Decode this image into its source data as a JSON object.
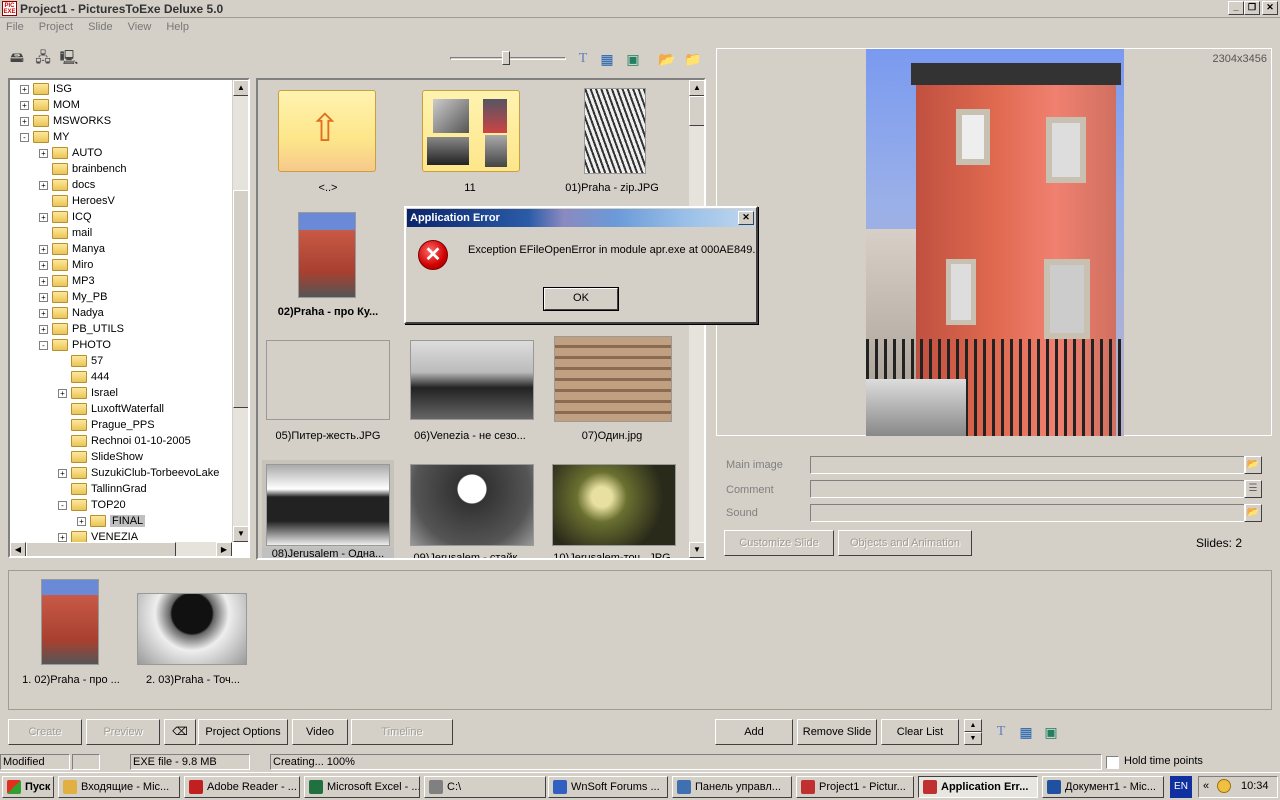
{
  "window": {
    "title": "Project1 - PicturesToExe Deluxe 5.0",
    "app_icon_text": "PIC EXE"
  },
  "menu": [
    "File",
    "Project",
    "Slide",
    "View",
    "Help"
  ],
  "tree": {
    "items": [
      {
        "label": "ISG",
        "indent": 1,
        "pm": "+"
      },
      {
        "label": "MOM",
        "indent": 1,
        "pm": "+"
      },
      {
        "label": "MSWORKS",
        "indent": 1,
        "pm": "+"
      },
      {
        "label": "MY",
        "indent": 1,
        "pm": "-"
      },
      {
        "label": "AUTO",
        "indent": 2,
        "pm": "+"
      },
      {
        "label": "brainbench",
        "indent": 2,
        "pm": ""
      },
      {
        "label": "docs",
        "indent": 2,
        "pm": "+"
      },
      {
        "label": "HeroesV",
        "indent": 2,
        "pm": ""
      },
      {
        "label": "ICQ",
        "indent": 2,
        "pm": "+"
      },
      {
        "label": "mail",
        "indent": 2,
        "pm": ""
      },
      {
        "label": "Manya",
        "indent": 2,
        "pm": "+"
      },
      {
        "label": "Miro",
        "indent": 2,
        "pm": "+"
      },
      {
        "label": "MP3",
        "indent": 2,
        "pm": "+"
      },
      {
        "label": "My_PB",
        "indent": 2,
        "pm": "+"
      },
      {
        "label": "Nadya",
        "indent": 2,
        "pm": "+"
      },
      {
        "label": "PB_UTILS",
        "indent": 2,
        "pm": "+"
      },
      {
        "label": "PHOTO",
        "indent": 2,
        "pm": "-"
      },
      {
        "label": "57",
        "indent": 3,
        "pm": ""
      },
      {
        "label": "444",
        "indent": 3,
        "pm": ""
      },
      {
        "label": "Israel",
        "indent": 3,
        "pm": "+"
      },
      {
        "label": "LuxoftWaterfall",
        "indent": 3,
        "pm": ""
      },
      {
        "label": "Prague_PPS",
        "indent": 3,
        "pm": ""
      },
      {
        "label": "Rechnoi 01-10-2005",
        "indent": 3,
        "pm": ""
      },
      {
        "label": "SlideShow",
        "indent": 3,
        "pm": ""
      },
      {
        "label": "SuzukiClub-TorbeevoLake",
        "indent": 3,
        "pm": "+"
      },
      {
        "label": "TallinnGrad",
        "indent": 3,
        "pm": ""
      },
      {
        "label": "TOP20",
        "indent": 3,
        "pm": "-"
      },
      {
        "label": "FINAL",
        "indent": 4,
        "pm": "+",
        "selected": true
      },
      {
        "label": "VENEZIA",
        "indent": 3,
        "pm": "+"
      }
    ]
  },
  "thumbs": [
    {
      "caption": "<..>",
      "kind": "up-folder"
    },
    {
      "caption": "11",
      "kind": "folder"
    },
    {
      "caption": "01)Praha - zip.JPG",
      "kind": "photo"
    },
    {
      "caption": "02)Praha - про Ку...",
      "kind": "photo",
      "bold": true
    },
    {
      "caption": "05)Питер-жесть.JPG",
      "kind": "photo"
    },
    {
      "caption": "06)Venezia - не сезо...",
      "kind": "photo"
    },
    {
      "caption": "07)Один.jpg",
      "kind": "photo"
    },
    {
      "caption": "08)Jerusalem - Одна...",
      "kind": "photo"
    },
    {
      "caption": "09)Jerusalem - стайк...",
      "kind": "photo"
    },
    {
      "caption": "10)Jerusalem-точ...JPG",
      "kind": "photo"
    }
  ],
  "preview": {
    "dimensions": "2304x3456"
  },
  "props": {
    "main_image_label": "Main image",
    "comment_label": "Comment",
    "sound_label": "Sound",
    "customize_label": "Customize Slide",
    "objects_label": "Objects and Animation",
    "slides_count": "Slides: 2"
  },
  "slides": [
    {
      "caption": "1. 02)Praha - про ..."
    },
    {
      "caption": "2. 03)Praha - Точ..."
    }
  ],
  "bottom": {
    "create": "Create",
    "preview": "Preview",
    "project_options": "Project Options",
    "video": "Video",
    "timeline": "Timeline",
    "add": "Add",
    "remove_slide": "Remove Slide",
    "clear_list": "Clear List"
  },
  "status": {
    "state": "Modified",
    "exe": "EXE file - 9.8 MB",
    "progress": "Creating... 100%",
    "hold": "Hold time points"
  },
  "dialog": {
    "title": "Application Error",
    "message": "Exception EFileOpenError in module apr.exe at 000AE849.",
    "ok": "OK"
  },
  "taskbar": {
    "start": "Пуск",
    "tasks": [
      {
        "label": "Входящие - Mic...",
        "color": "#e0b040"
      },
      {
        "label": "Adobe Reader - ...",
        "color": "#c02020"
      },
      {
        "label": "Microsoft Excel - ...",
        "color": "#207040"
      },
      {
        "label": "C:\\",
        "color": "#808080"
      },
      {
        "label": "WnSoft Forums ...",
        "color": "#3060c0"
      },
      {
        "label": "Панель управл...",
        "color": "#4070b0"
      },
      {
        "label": "Project1 - Pictur...",
        "color": "#c03030"
      },
      {
        "label": "Application Err...",
        "color": "#c03030",
        "active": true
      },
      {
        "label": "Документ1 - Mic...",
        "color": "#2050a0"
      }
    ],
    "lang": "EN",
    "time": "10:34"
  }
}
